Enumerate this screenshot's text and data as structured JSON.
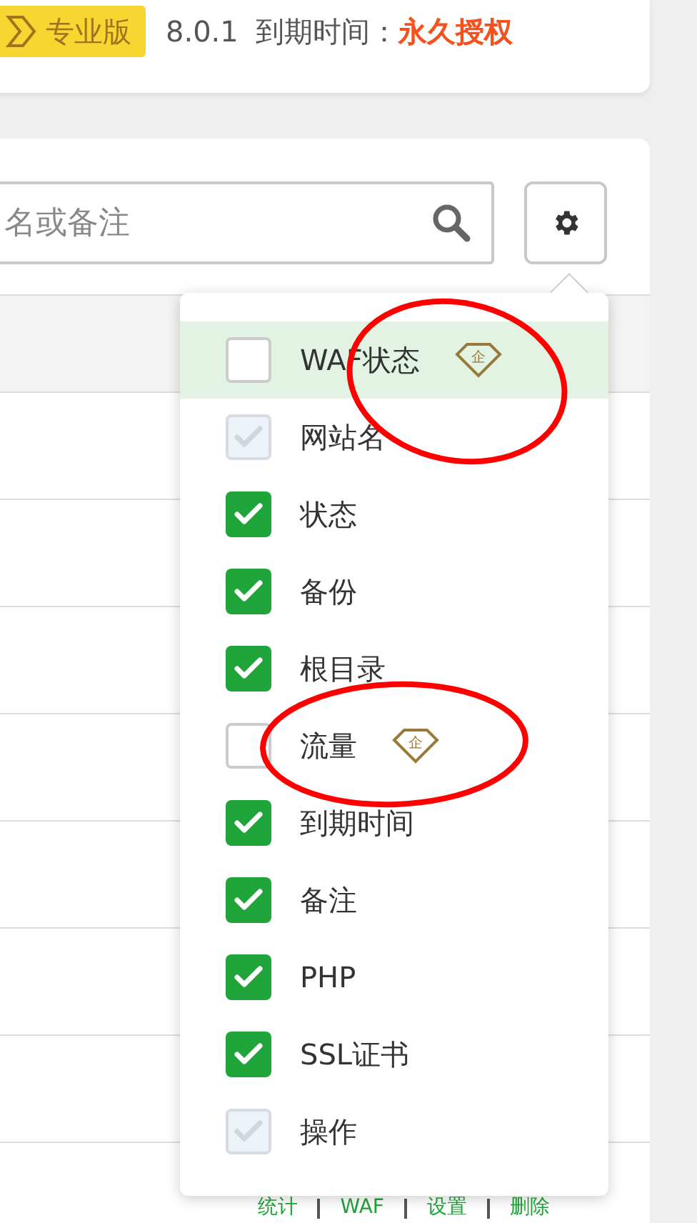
{
  "header": {
    "edition": "专业版",
    "version": "8.0.1",
    "expiry_label": "到期时间：",
    "expiry_value": "永久授权"
  },
  "search": {
    "placeholder": "名或备注"
  },
  "table": {
    "last_row_actions": [
      "统计",
      "WAF",
      "设置",
      "删除"
    ]
  },
  "column_menu": {
    "items": [
      {
        "label": "WAF状态",
        "checked": false,
        "disabled": false,
        "highlighted": true,
        "badge": "企"
      },
      {
        "label": "网站名",
        "checked": true,
        "disabled": true,
        "highlighted": false
      },
      {
        "label": "状态",
        "checked": true,
        "disabled": false,
        "highlighted": false
      },
      {
        "label": "备份",
        "checked": true,
        "disabled": false,
        "highlighted": false
      },
      {
        "label": "根目录",
        "checked": true,
        "disabled": false,
        "highlighted": false
      },
      {
        "label": "流量",
        "checked": false,
        "disabled": false,
        "highlighted": false,
        "badge": "企"
      },
      {
        "label": "到期时间",
        "checked": true,
        "disabled": false,
        "highlighted": false
      },
      {
        "label": "备注",
        "checked": true,
        "disabled": false,
        "highlighted": false
      },
      {
        "label": "PHP",
        "checked": true,
        "disabled": false,
        "highlighted": false
      },
      {
        "label": "SSL证书",
        "checked": true,
        "disabled": false,
        "highlighted": false
      },
      {
        "label": "操作",
        "checked": true,
        "disabled": true,
        "highlighted": false
      }
    ]
  }
}
